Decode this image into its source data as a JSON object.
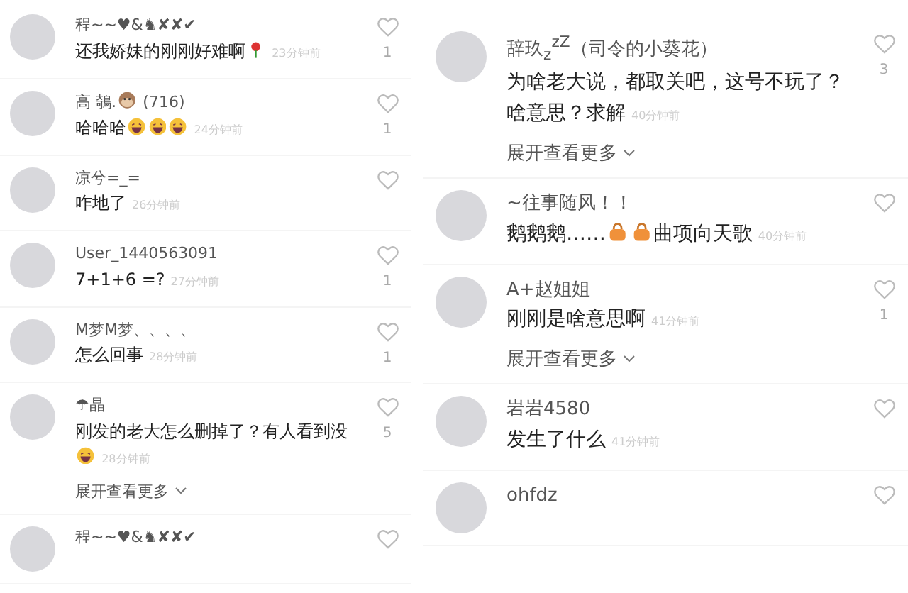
{
  "panels": [
    {
      "comments": [
        {
          "name": [
            {
              "kind": "text",
              "text": "程~~♥&♞✘✘✔"
            }
          ],
          "text": [
            {
              "kind": "text",
              "text": "还我娇妹的刚刚好难啊"
            },
            {
              "kind": "rose"
            }
          ],
          "time": "23分钟前",
          "likes": "1"
        },
        {
          "name": [
            {
              "kind": "text",
              "text": "高 鵸."
            },
            {
              "kind": "monkey"
            },
            {
              "kind": "text",
              "text": " (716)"
            }
          ],
          "text": [
            {
              "kind": "text",
              "text": "哈哈哈"
            },
            {
              "kind": "laugh"
            },
            {
              "kind": "laugh"
            },
            {
              "kind": "laugh"
            }
          ],
          "time": "24分钟前",
          "likes": "1"
        },
        {
          "name": [
            {
              "kind": "text",
              "text": "凉兮=_="
            }
          ],
          "text": [
            {
              "kind": "text",
              "text": "咋地了"
            }
          ],
          "time": "26分钟前"
        },
        {
          "name": [
            {
              "kind": "text",
              "text": "User_1440563091"
            }
          ],
          "text": [
            {
              "kind": "text",
              "text": "7+1+6  =?"
            }
          ],
          "time": "27分钟前",
          "likes": "1"
        },
        {
          "name": [
            {
              "kind": "text",
              "text": "M梦M梦、、、、"
            }
          ],
          "text": [
            {
              "kind": "text",
              "text": "怎么回事"
            }
          ],
          "time": "28分钟前",
          "likes": "1"
        },
        {
          "name": [
            {
              "kind": "text",
              "text": "☂晶"
            }
          ],
          "text": [
            {
              "kind": "text",
              "text": "刚发的老大怎么删掉了？有人看到没"
            },
            {
              "kind": "break"
            },
            {
              "kind": "laugh"
            }
          ],
          "time": "28分钟前",
          "likes": "5",
          "more": "展开查看更多"
        },
        {
          "name": [
            {
              "kind": "text",
              "text": "程~~♥&♞✘✘✔"
            }
          ]
        }
      ]
    },
    {
      "comments": [
        {
          "name": [
            {
              "kind": "text",
              "text": "辞玖$_{z}$$^{z}$$^{Z}$（司令的小葵花）"
            }
          ],
          "text": [
            {
              "kind": "text",
              "text": "为啥老大说，都取关吧，这号不玩了？啥意思？求解"
            }
          ],
          "time": "40分钟前",
          "likes": "3",
          "more": "展开查看更多"
        },
        {
          "name": [
            {
              "kind": "text",
              "text": "~往事随风！！"
            }
          ],
          "text": [
            {
              "kind": "text",
              "text": "鹅鹅鹅……"
            },
            {
              "kind": "bag"
            },
            {
              "kind": "bag"
            },
            {
              "kind": "text",
              "text": "曲项向天歌"
            }
          ],
          "time": "40分钟前"
        },
        {
          "name": [
            {
              "kind": "text",
              "text": "A+赵姐姐"
            }
          ],
          "text": [
            {
              "kind": "text",
              "text": "刚刚是啥意思啊"
            }
          ],
          "time": "41分钟前",
          "likes": "1",
          "more": "展开查看更多"
        },
        {
          "name": [
            {
              "kind": "text",
              "text": "岩岩4580"
            }
          ],
          "text": [
            {
              "kind": "text",
              "text": "发生了什么"
            }
          ],
          "time": "41分钟前"
        },
        {
          "name": [
            {
              "kind": "text",
              "text": "ohfdz"
            }
          ]
        }
      ]
    }
  ]
}
